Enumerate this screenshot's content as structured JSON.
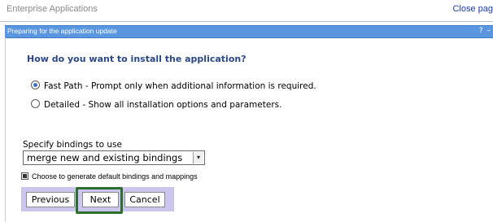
{
  "header": {
    "title": "Enterprise Applications",
    "close_link": "Close pag"
  },
  "panel": {
    "title": "Preparing for the application update",
    "title_icons": "? –"
  },
  "question": "How do you want to install the application?",
  "options": [
    {
      "label": "Fast Path - Prompt only when additional information is required.",
      "selected": true
    },
    {
      "label": "Detailed - Show all installation options and parameters.",
      "selected": false
    }
  ],
  "bindings": {
    "label": "Specify bindings to use",
    "selected": "merge new and existing bindings",
    "arrow": "▾"
  },
  "checkbox": {
    "label": "Choose to generate default bindings and mappings"
  },
  "buttons": {
    "previous": "Previous",
    "next": "Next",
    "cancel": "Cancel"
  },
  "colors": {
    "titlebar": "#5b97e0",
    "button_bar": "#ccc6ee",
    "highlight": "#2e6e2c",
    "question": "#2a4888"
  }
}
